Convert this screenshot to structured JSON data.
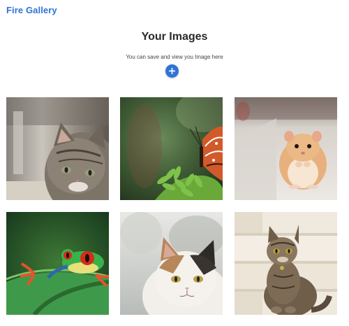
{
  "nav": {
    "brand": "Fire Gallery"
  },
  "header": {
    "title": "Your Images",
    "subtitle": "You can save and view you Image here"
  },
  "colors": {
    "accent": "#2f73d6"
  },
  "actions": {
    "add_icon": "plus-icon"
  },
  "gallery": {
    "images": [
      {
        "subject": "kitten"
      },
      {
        "subject": "butterfly-on-fern"
      },
      {
        "subject": "hamster"
      },
      {
        "subject": "red-eyed-tree-frog"
      },
      {
        "subject": "calico-cat"
      },
      {
        "subject": "tabby-cat-sitting"
      }
    ]
  }
}
